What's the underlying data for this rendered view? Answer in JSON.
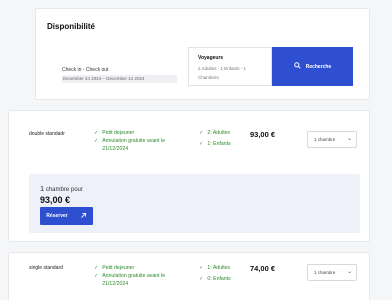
{
  "availability": {
    "title": "Disponibilité",
    "dates_label": "Check in - Check out",
    "dates_value": "December 24 2024 – December 14 2024",
    "travelers_label": "Voyageurs",
    "travelers_value": "2 Adultes - 1 Enfants - 1 Chambres",
    "search_label": "Recherche",
    "search_icon": "search-icon"
  },
  "rooms": [
    {
      "name": "double standadr",
      "features": [
        "Petit dejeuner",
        "Annulation gratuite avant le 21/12/2024"
      ],
      "occupancy": [
        "2: Adultes",
        "1: Enfants"
      ],
      "price": "93,00 €",
      "select_value": "1 chambre",
      "summary": {
        "count_number": "1",
        "count_text": "chambre pour",
        "total": "93,00 €",
        "reserve_label": "Réserver",
        "reserve_icon": "arrow-up-right-icon"
      }
    },
    {
      "name": "single standard",
      "features": [
        "Petit dejeuner",
        "Annulation gratuite avant le 21/12/2024"
      ],
      "occupancy": [
        "1: Adultes",
        "0: Enfants"
      ],
      "price": "74,00 €",
      "select_value": "1 chambre"
    }
  ],
  "colors": {
    "accent": "#2f4fd1",
    "success": "#2a8a2a",
    "summary_bg": "#eef0fa"
  }
}
